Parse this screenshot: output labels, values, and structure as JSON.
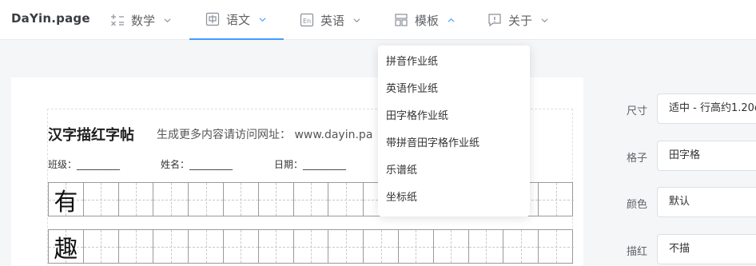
{
  "header": {
    "logo": "DaYin.page",
    "nav": [
      {
        "label": "数学",
        "icon": "math-icon"
      },
      {
        "label": "语文",
        "icon": "chinese-char-icon"
      },
      {
        "label": "英语",
        "icon": "english-icon"
      },
      {
        "label": "模板",
        "icon": "template-icon"
      },
      {
        "label": "关于",
        "icon": "info-icon"
      }
    ]
  },
  "dropdown": {
    "items": [
      "拼音作业纸",
      "英语作业纸",
      "田字格作业纸",
      "带拼音田字格作业纸",
      "乐谱纸",
      "坐标纸"
    ]
  },
  "sheet": {
    "title": "汉字描红字帖",
    "subtitle": "生成更多内容请访问网址： www.dayin.pa",
    "fields": [
      "班级：_________",
      "姓名：_________",
      "日期：_________"
    ],
    "rows": [
      {
        "char": "有"
      },
      {
        "char": "趣"
      }
    ]
  },
  "settings": [
    {
      "label": "尺寸",
      "value": "适中 - 行高约1.20c"
    },
    {
      "label": "格子",
      "value": "田字格"
    },
    {
      "label": "颜色",
      "value": "默认"
    },
    {
      "label": "描红",
      "value": "不描"
    }
  ],
  "colors": {
    "accent": "#409eff",
    "grid": "#9a9a9a"
  }
}
